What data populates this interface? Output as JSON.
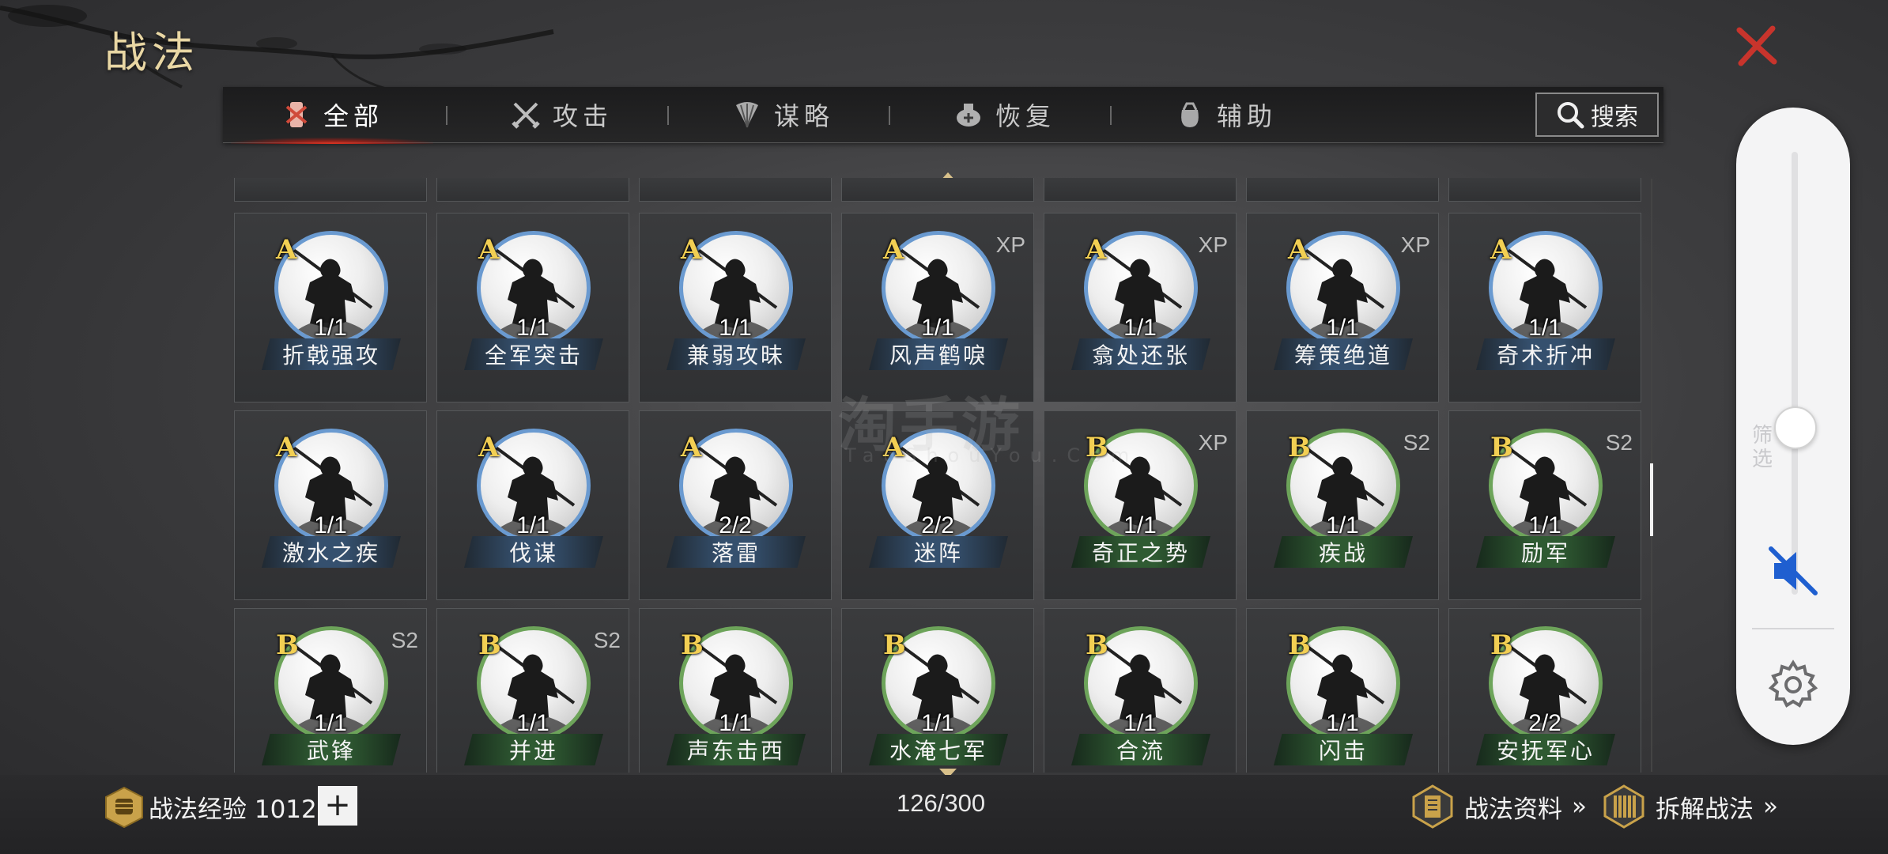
{
  "title": "战法",
  "close_icon": "close-x-icon",
  "tabs": [
    {
      "label": "全部",
      "icon": "all-scroll-icon",
      "active": true
    },
    {
      "label": "攻击",
      "icon": "crossed-swords-icon",
      "active": false
    },
    {
      "label": "谋略",
      "icon": "feather-fan-icon",
      "active": false
    },
    {
      "label": "恢复",
      "icon": "healing-pot-icon",
      "active": false
    },
    {
      "label": "辅助",
      "icon": "support-bag-icon",
      "active": false
    }
  ],
  "search": {
    "label": "搜索",
    "icon": "search-icon"
  },
  "watermark": {
    "main": "淘手游",
    "sub": "TaoShouYou.Com"
  },
  "skills": [
    {
      "grade": "A",
      "tag": "",
      "level": "1/1",
      "name": "折戟强攻",
      "color": "blue"
    },
    {
      "grade": "A",
      "tag": "",
      "level": "1/1",
      "name": "全军突击",
      "color": "blue"
    },
    {
      "grade": "A",
      "tag": "",
      "level": "1/1",
      "name": "兼弱攻昧",
      "color": "blue"
    },
    {
      "grade": "A",
      "tag": "XP",
      "level": "1/1",
      "name": "风声鹤唳",
      "color": "blue"
    },
    {
      "grade": "A",
      "tag": "XP",
      "level": "1/1",
      "name": "翕处还张",
      "color": "blue"
    },
    {
      "grade": "A",
      "tag": "XP",
      "level": "1/1",
      "name": "筹策绝道",
      "color": "blue"
    },
    {
      "grade": "A",
      "tag": "",
      "level": "1/1",
      "name": "奇术折冲",
      "color": "blue"
    },
    {
      "grade": "A",
      "tag": "",
      "level": "1/1",
      "name": "激水之疾",
      "color": "blue"
    },
    {
      "grade": "A",
      "tag": "",
      "level": "1/1",
      "name": "伐谋",
      "color": "blue"
    },
    {
      "grade": "A",
      "tag": "",
      "level": "2/2",
      "name": "落雷",
      "color": "blue"
    },
    {
      "grade": "A",
      "tag": "",
      "level": "2/2",
      "name": "迷阵",
      "color": "blue"
    },
    {
      "grade": "B",
      "tag": "XP",
      "level": "1/1",
      "name": "奇正之势",
      "color": "green"
    },
    {
      "grade": "B",
      "tag": "S2",
      "level": "1/1",
      "name": "疾战",
      "color": "green"
    },
    {
      "grade": "B",
      "tag": "S2",
      "level": "1/1",
      "name": "励军",
      "color": "green"
    },
    {
      "grade": "B",
      "tag": "S2",
      "level": "1/1",
      "name": "武锋",
      "color": "green"
    },
    {
      "grade": "B",
      "tag": "S2",
      "level": "1/1",
      "name": "并进",
      "color": "green"
    },
    {
      "grade": "B",
      "tag": "",
      "level": "1/1",
      "name": "声东击西",
      "color": "green"
    },
    {
      "grade": "B",
      "tag": "",
      "level": "1/1",
      "name": "水淹七军",
      "color": "green"
    },
    {
      "grade": "B",
      "tag": "",
      "level": "1/1",
      "name": "合流",
      "color": "green"
    },
    {
      "grade": "B",
      "tag": "",
      "level": "1/1",
      "name": "闪击",
      "color": "green"
    },
    {
      "grade": "B",
      "tag": "",
      "level": "2/2",
      "name": "安抚军心",
      "color": "green"
    }
  ],
  "footer": {
    "exp_label": "战法经验",
    "exp_value": "1012",
    "exp_icon": "fist-badge-icon",
    "plus_label": "+",
    "count": "126/300",
    "link_info": "战法资料",
    "link_info_icon": "scroll-book-icon",
    "link_dismantle": "拆解战法",
    "link_dismantle_icon": "bamboo-slips-icon",
    "chevrons": "»"
  },
  "side_panel": {
    "ghost_label": "筛选",
    "volume_level": 0.38,
    "mute_icon": "volume-muted-icon",
    "settings_icon": "gear-icon"
  },
  "colors": {
    "accent_red": "#e0321f",
    "grade_gold": "#f2cf53",
    "ring_a": "#6a9ad0",
    "ring_b": "#6da45a",
    "title_gold": "#e9d7a4"
  }
}
